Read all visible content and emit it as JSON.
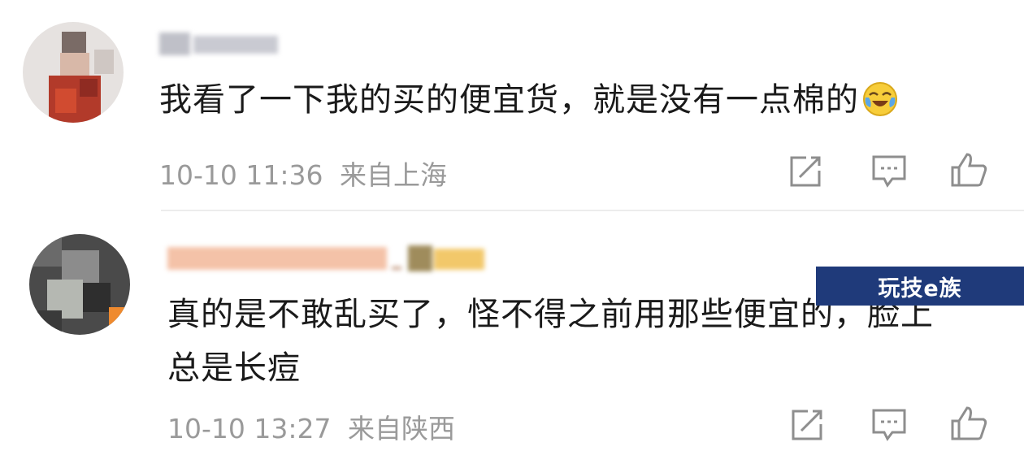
{
  "comments": [
    {
      "text": "我看了一下我的买的便宜货，就是没有一点棉的",
      "emoji": "laughing-crying-emoji",
      "time": "10-10 11:36",
      "location": "来自上海"
    },
    {
      "text_line1": "真的是不敢乱买了，怪不得之前用那些便宜的，脸上",
      "text_line2": "总是长痘",
      "time": "10-10 13:27",
      "location": "来自陕西"
    }
  ],
  "watermark": {
    "text": "玩技e族"
  },
  "icons": [
    "share-icon",
    "comment-icon",
    "like-icon"
  ],
  "colors": {
    "text": "#1a1a1a",
    "meta": "#9a9a9a",
    "watermark_bg": "#1f3a7a"
  }
}
